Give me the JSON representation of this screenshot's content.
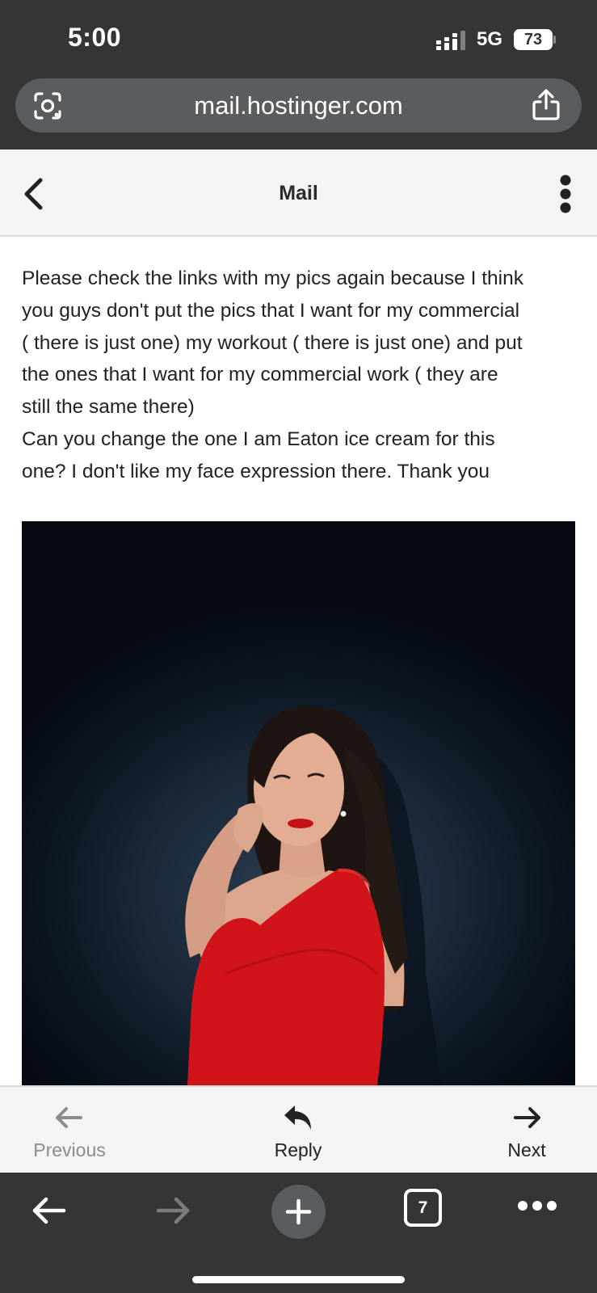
{
  "status_bar": {
    "time": "5:00",
    "network": "5G",
    "battery": "73",
    "icons": [
      "signal-icon",
      "battery-icon"
    ]
  },
  "browser": {
    "url": "mail.hostinger.com",
    "icons": [
      "screenshot-lens-icon",
      "share-icon"
    ],
    "toolbar": {
      "tab_count": "7",
      "icons": [
        "back-arrow-icon",
        "forward-arrow-icon",
        "new-tab-plus-icon",
        "tabs-icon",
        "more-icon"
      ]
    }
  },
  "mail_header": {
    "title": "Mail",
    "icons": [
      "back-chevron-icon",
      "kebab-menu-icon"
    ]
  },
  "message": {
    "lines": [
      "Please check the links with my pics again because I think",
      "you guys don't put the pics that I want for my  commercial",
      "( there is just one) my workout ( there is just one) and put",
      "the ones that I want for my commercial work ( they are",
      "still the same there)",
      "Can you change the one I am Eaton ice cream for this",
      "one? I don't like my face expression there. Thank you"
    ],
    "attachment": "inline-photo"
  },
  "mail_actions": {
    "previous": "Previous",
    "reply": "Reply",
    "next": "Next"
  },
  "colors": {
    "chrome_dark": "#333537",
    "url_bar": "#5a5d60",
    "header_bg": "#f4f4f4",
    "dress_red": "#d0141a",
    "disabled": "#8c8c8c"
  }
}
